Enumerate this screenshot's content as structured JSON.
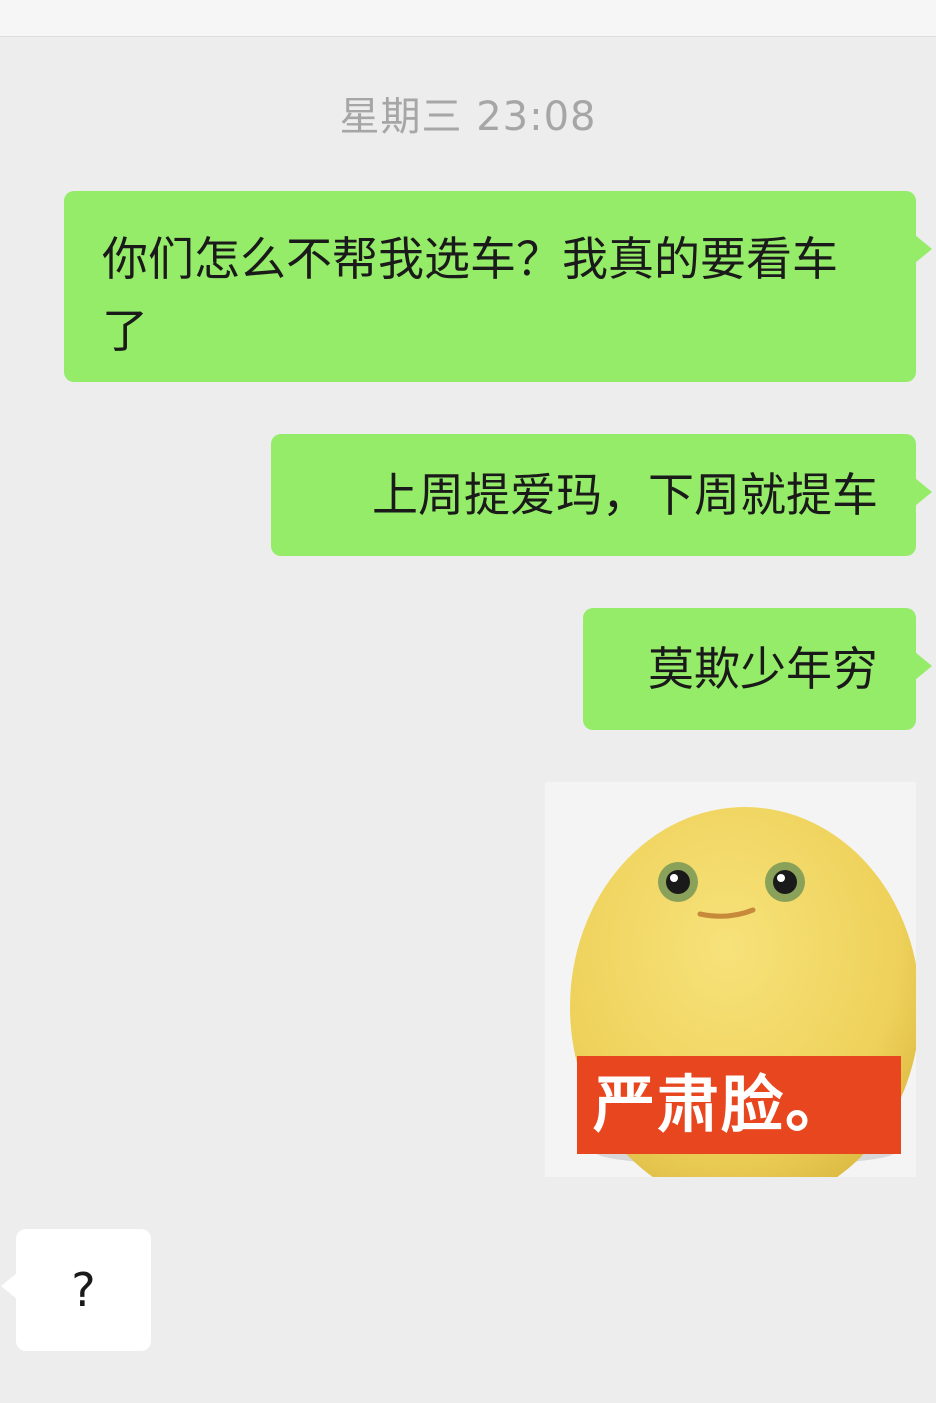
{
  "chat": {
    "timestamp": "星期三 23:08",
    "messages": [
      {
        "side": "right",
        "type": "text",
        "text": "你们怎么不帮我选车？我真的要看车了"
      },
      {
        "side": "right",
        "type": "text",
        "text": "上周提爱玛，下周就提车"
      },
      {
        "side": "right",
        "type": "text",
        "text": "莫欺少年穷"
      },
      {
        "side": "right",
        "type": "sticker",
        "caption": "严肃脸。",
        "icon": "yellow-egg-face"
      },
      {
        "side": "left",
        "type": "text",
        "text": "?"
      }
    ]
  },
  "colors": {
    "background": "#ededed",
    "outgoing_bubble": "#95ec69",
    "incoming_bubble": "#ffffff",
    "timestamp": "#a6a6a6",
    "sticker_caption_bg": "#e8461f"
  }
}
